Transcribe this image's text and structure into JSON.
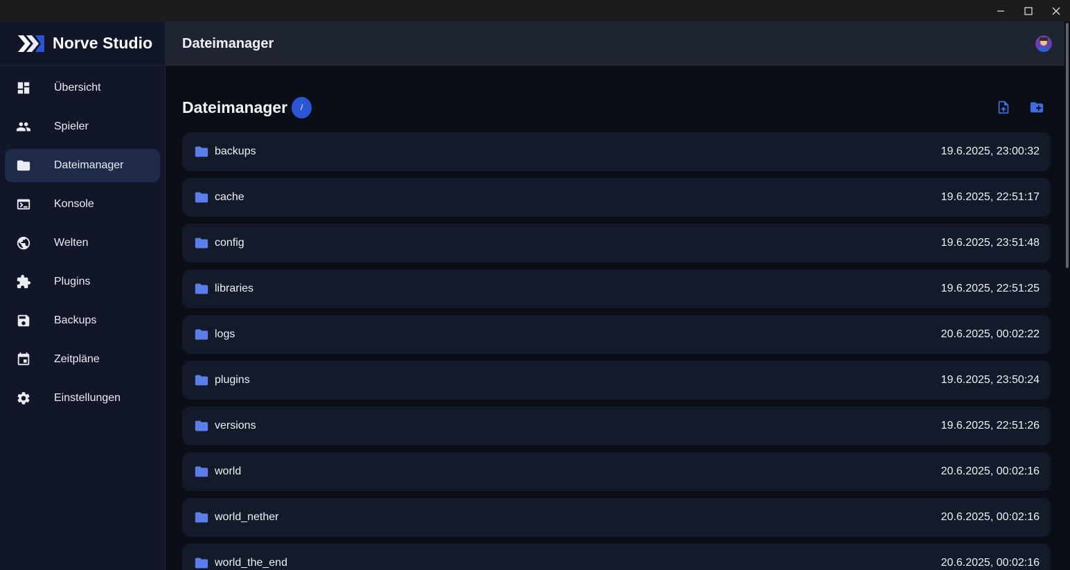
{
  "app": {
    "name": "Norve Studio",
    "header_title": "Dateimanager"
  },
  "window_controls": {
    "minimize_icon": "minimize-icon",
    "maximize_icon": "maximize-icon",
    "close_icon": "close-icon"
  },
  "sidebar": {
    "items": [
      {
        "label": "Übersicht",
        "icon": "dashboard-icon",
        "active": false
      },
      {
        "label": "Spieler",
        "icon": "people-icon",
        "active": false
      },
      {
        "label": "Dateimanager",
        "icon": "folder-icon",
        "active": true
      },
      {
        "label": "Konsole",
        "icon": "terminal-icon",
        "active": false
      },
      {
        "label": "Welten",
        "icon": "globe-icon",
        "active": false
      },
      {
        "label": "Plugins",
        "icon": "puzzle-icon",
        "active": false
      },
      {
        "label": "Backups",
        "icon": "save-icon",
        "active": false
      },
      {
        "label": "Zeitpläne",
        "icon": "calendar-icon",
        "active": false
      },
      {
        "label": "Einstellungen",
        "icon": "gear-icon",
        "active": false
      }
    ]
  },
  "main": {
    "title": "Dateimanager",
    "path": "/",
    "actions": {
      "upload_icon": "file-upload-icon",
      "new_folder_icon": "folder-add-icon"
    },
    "files": [
      {
        "name": "backups",
        "date": "19.6.2025, 23:00:32"
      },
      {
        "name": "cache",
        "date": "19.6.2025, 22:51:17"
      },
      {
        "name": "config",
        "date": "19.6.2025, 23:51:48"
      },
      {
        "name": "libraries",
        "date": "19.6.2025, 22:51:25"
      },
      {
        "name": "logs",
        "date": "20.6.2025, 00:02:22"
      },
      {
        "name": "plugins",
        "date": "19.6.2025, 23:50:24"
      },
      {
        "name": "versions",
        "date": "19.6.2025, 22:51:26"
      },
      {
        "name": "world",
        "date": "20.6.2025, 00:02:16"
      },
      {
        "name": "world_nether",
        "date": "20.6.2025, 00:02:16"
      },
      {
        "name": "world_the_end",
        "date": "20.6.2025, 00:02:16"
      }
    ]
  },
  "colors": {
    "accent": "#2a56d6",
    "folder": "#5b7ee8",
    "sidebar_bg": "#111728",
    "header_bg": "#1f2433",
    "main_bg": "#0b0e17",
    "row_bg": "#131a2a"
  }
}
